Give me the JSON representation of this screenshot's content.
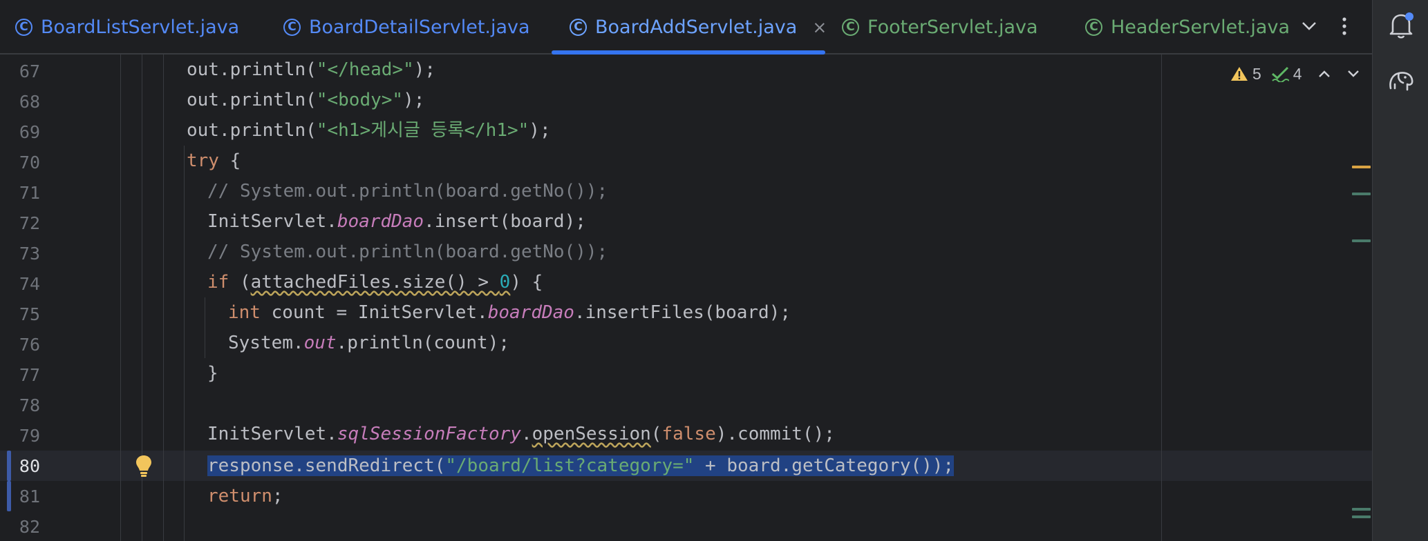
{
  "tabs": [
    {
      "label": "BoardListServlet.java",
      "icon": "class-icon",
      "color": "#548af7"
    },
    {
      "label": "BoardDetailServlet.java",
      "icon": "class-icon",
      "color": "#548af7"
    },
    {
      "label": "BoardAddServlet.java",
      "icon": "class-icon",
      "active": true,
      "color": "#6da3ff"
    },
    {
      "label": "FooterServlet.java",
      "icon": "class-icon",
      "color": "#6aab73"
    },
    {
      "label": "HeaderServlet.java",
      "icon": "class-icon",
      "color": "#6aab73"
    }
  ],
  "tab_icon_glyph": "C",
  "tab_close_glyph": "×",
  "inspections": {
    "warnings": "5",
    "weak_warnings": "4"
  },
  "gutter": {
    "lines": [
      "67",
      "68",
      "69",
      "70",
      "71",
      "72",
      "73",
      "74",
      "75",
      "76",
      "77",
      "78",
      "79",
      "80",
      "81",
      "82"
    ],
    "current_line": "80"
  },
  "code": {
    "l67": {
      "a": "out.println(",
      "s": "\"</head>\"",
      "b": ");"
    },
    "l68": {
      "a": "out.println(",
      "s": "\"<body>\"",
      "b": ");"
    },
    "l69": {
      "a": "out.println(",
      "s": "\"<h1>게시글 등록</h1>\"",
      "b": ");"
    },
    "l70": {
      "kw": "try",
      "b": " {"
    },
    "l71": {
      "c": "// System.out.println(board.getNo());"
    },
    "l72": {
      "a": "InitServlet.",
      "f": "boardDao",
      "b": ".insert(board);"
    },
    "l73": {
      "c": "// System.out.println(board.getNo());"
    },
    "l74": {
      "kw": "if",
      "a": " (",
      "w": "attachedFiles.size() > ",
      "n": "0",
      "b": ") {"
    },
    "l75": {
      "kw": "int",
      "a": " count = InitServlet.",
      "f": "boardDao",
      "b": ".insertFiles(board);"
    },
    "l76": {
      "a": "System.",
      "f": "out",
      "b": ".println(count);"
    },
    "l77": {
      "b": "}"
    },
    "l79": {
      "a": "InitServlet.",
      "f": "sqlSessionFactory",
      "d": ".",
      "w": "openSession",
      "p": "(",
      "kw": "false",
      "b": ").commit();"
    },
    "l80": {
      "a": "response.sendRedirect(",
      "s": "\"/board/list?category=\"",
      "b": " + board.getCategory());"
    },
    "l81": {
      "kw": "return",
      "b": ";"
    }
  },
  "colors": {
    "background": "#1e1f22",
    "keyword": "#cf8e6d",
    "string": "#6aab73",
    "number": "#2aacb8",
    "comment": "#7a7e85",
    "static_field": "#c77dbb",
    "selection": "#214283",
    "accent": "#3574f0",
    "warning": "#f2c55c"
  }
}
